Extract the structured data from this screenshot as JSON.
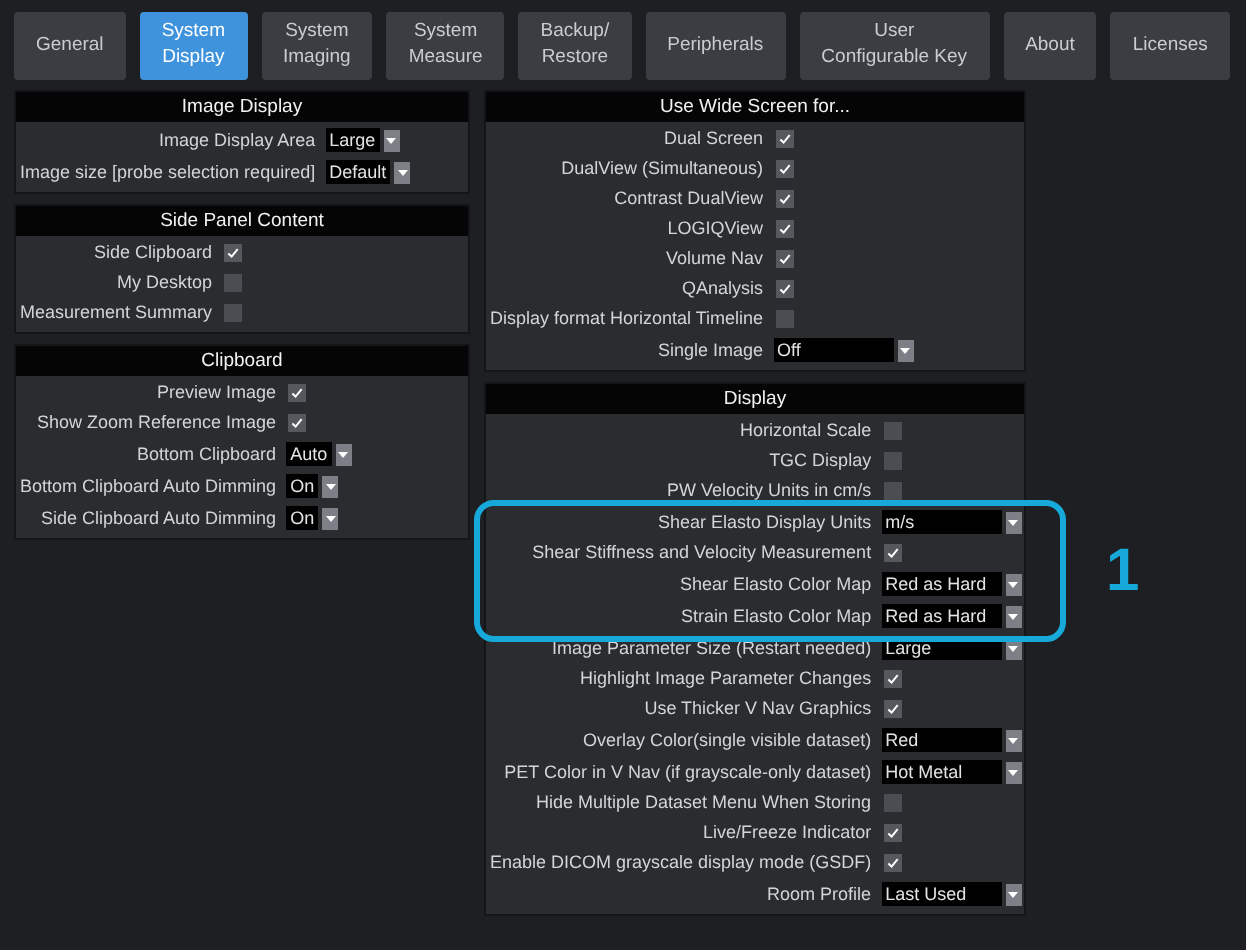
{
  "tabs": [
    {
      "label": "General",
      "selected": false
    },
    {
      "label": "System\nDisplay",
      "selected": true
    },
    {
      "label": "System\nImaging",
      "selected": false
    },
    {
      "label": "System\nMeasure",
      "selected": false
    },
    {
      "label": "Backup/\nRestore",
      "selected": false
    },
    {
      "label": "Peripherals",
      "selected": false
    },
    {
      "label": "User\nConfigurable Key",
      "selected": false
    },
    {
      "label": "About",
      "selected": false
    },
    {
      "label": "Licenses",
      "selected": false
    }
  ],
  "left_panels": [
    {
      "title": "Image Display",
      "rows": [
        {
          "kind": "dropdown",
          "label": "Image Display Area",
          "value": "Large"
        },
        {
          "kind": "dropdown",
          "label": "Image size [probe selection required]",
          "value": "Default"
        }
      ]
    },
    {
      "title": "Side Panel Content",
      "rows": [
        {
          "kind": "checkbox",
          "label": "Side Clipboard",
          "checked": true
        },
        {
          "kind": "checkbox",
          "label": "My Desktop",
          "checked": false
        },
        {
          "kind": "checkbox",
          "label": "Measurement Summary",
          "checked": false
        }
      ]
    },
    {
      "title": "Clipboard",
      "rows": [
        {
          "kind": "checkbox",
          "label": "Preview Image",
          "checked": true
        },
        {
          "kind": "checkbox",
          "label": "Show Zoom Reference Image",
          "checked": true
        },
        {
          "kind": "dropdown",
          "label": "Bottom Clipboard",
          "value": "Auto"
        },
        {
          "kind": "dropdown",
          "label": "Bottom Clipboard Auto Dimming",
          "value": "On"
        },
        {
          "kind": "dropdown",
          "label": "Side Clipboard Auto Dimming",
          "value": "On"
        }
      ]
    }
  ],
  "right_panels": [
    {
      "title": "Use Wide Screen for...",
      "rows": [
        {
          "kind": "checkbox",
          "label": "Dual Screen",
          "checked": true
        },
        {
          "kind": "checkbox",
          "label": "DualView (Simultaneous)",
          "checked": true
        },
        {
          "kind": "checkbox",
          "label": "Contrast DualView",
          "checked": true
        },
        {
          "kind": "checkbox",
          "label": "LOGIQView",
          "checked": true
        },
        {
          "kind": "checkbox",
          "label": "Volume Nav",
          "checked": true
        },
        {
          "kind": "checkbox",
          "label": "QAnalysis",
          "checked": true
        },
        {
          "kind": "checkbox",
          "label": "Display format Horizontal Timeline",
          "checked": false
        },
        {
          "kind": "dropdown",
          "label": "Single Image",
          "value": "Off"
        }
      ]
    },
    {
      "title": "Display",
      "rows": [
        {
          "kind": "checkbox",
          "label": "Horizontal Scale",
          "checked": false
        },
        {
          "kind": "checkbox",
          "label": "TGC Display",
          "checked": false
        },
        {
          "kind": "checkbox",
          "label": "PW Velocity Units in cm/s",
          "checked": false
        },
        {
          "kind": "dropdown",
          "label": "Shear Elasto Display Units",
          "value": "m/s"
        },
        {
          "kind": "checkbox",
          "label": "Shear Stiffness and Velocity Measurement",
          "checked": true
        },
        {
          "kind": "dropdown",
          "label": "Shear Elasto Color Map",
          "value": "Red as Hard"
        },
        {
          "kind": "dropdown",
          "label": "Strain Elasto Color Map",
          "value": "Red as Hard"
        },
        {
          "kind": "dropdown",
          "label": "Image Parameter Size (Restart needed)",
          "value": "Large"
        },
        {
          "kind": "checkbox",
          "label": "Highlight Image Parameter Changes",
          "checked": true
        },
        {
          "kind": "checkbox",
          "label": "Use Thicker V Nav Graphics",
          "checked": true
        },
        {
          "kind": "dropdown",
          "label": "Overlay Color(single visible dataset)",
          "value": "Red"
        },
        {
          "kind": "dropdown",
          "label": "PET Color in V Nav (if grayscale-only dataset)",
          "value": "Hot Metal"
        },
        {
          "kind": "checkbox",
          "label": "Hide Multiple Dataset Menu When Storing",
          "checked": false
        },
        {
          "kind": "checkbox",
          "label": "Live/Freeze Indicator",
          "checked": true
        },
        {
          "kind": "checkbox",
          "label": "Enable DICOM grayscale display mode (GSDF)",
          "checked": true
        },
        {
          "kind": "dropdown",
          "label": "Room Profile",
          "value": "Last Used"
        }
      ]
    }
  ],
  "callout": {
    "label": "1"
  }
}
